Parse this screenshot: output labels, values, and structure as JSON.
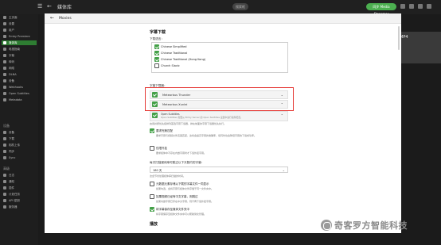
{
  "app": {
    "title": "媒体库",
    "pills": [
      "搜索框"
    ],
    "sync_label": "同步 Media Streamer"
  },
  "sidebar": {
    "items": [
      {
        "label": "主页面",
        "icon": "home-icon"
      },
      {
        "label": "设置",
        "icon": "gear-icon"
      },
      {
        "label": "用户",
        "icon": "user-icon"
      },
      {
        "label": "Emby Premiere",
        "icon": "star-icon"
      },
      {
        "label": "媒体库",
        "icon": "library-icon"
      },
      {
        "label": "电视指南",
        "icon": "tv-icon"
      },
      {
        "label": "字幕",
        "icon": "subtitle-icon"
      },
      {
        "label": "转码",
        "icon": "transcode-icon"
      },
      {
        "label": "网络",
        "icon": "network-icon"
      },
      {
        "label": "DLNA",
        "icon": "dlna-icon"
      },
      {
        "label": "设备",
        "icon": "device-icon"
      },
      {
        "label": "Webhooks",
        "icon": "webhook-icon"
      },
      {
        "label": "Open Subtitles",
        "icon": "plugin-icon"
      },
      {
        "label": "Metadata",
        "icon": "metadata-icon"
      }
    ],
    "section_heads": [
      "设备",
      "高级"
    ],
    "lower_items": [
      {
        "label": "设备",
        "icon": "device-icon"
      },
      {
        "label": "下载",
        "icon": "download-icon"
      },
      {
        "label": "相机上传",
        "icon": "camera-icon"
      },
      {
        "label": "同步",
        "icon": "sync-icon"
      },
      {
        "label": "Sync",
        "icon": "sync-icon"
      },
      {
        "label": "日志",
        "icon": "log-icon"
      },
      {
        "label": "通知",
        "icon": "bell-icon"
      },
      {
        "label": "插件",
        "icon": "plugin-icon"
      },
      {
        "label": "计划任务",
        "icon": "clock-icon"
      },
      {
        "label": "API 密钥",
        "icon": "key-icon"
      },
      {
        "label": "服务器",
        "icon": "server-icon"
      }
    ]
  },
  "background": {
    "right_text": "MP4"
  },
  "modal": {
    "title": "Movies",
    "section_subtitle_download": "字幕下载",
    "download_languages_label": "下载语言：",
    "languages": [
      {
        "name": "Chinese Simplified",
        "checked": true
      },
      {
        "name": "Chinese Traditional",
        "checked": true
      },
      {
        "name": "Chinese Traditional (Hong Kong)",
        "checked": true
      },
      {
        "name": "Church Slavic",
        "checked": false
      }
    ],
    "downloaders_label": "字幕下载器：",
    "downloaders": [
      {
        "name": "Meteorbus Thunder",
        "checked": true,
        "chevron": "⌄"
      },
      {
        "name": "Meteorbus Xunlei",
        "checked": true,
        "chevron": "⌃"
      }
    ],
    "open_subtitles": {
      "name": "Open Subtitles",
      "desc": "Open Subtitles 需要从 Emby Server 的 Open Subtitles 设置中进行插件配置。",
      "checked": true,
      "chevron": "⌃"
    },
    "downloader_order_desc": "启用并按优先级排列首选字幕下载器，排在前面的字幕下载器优先执行。",
    "options": [
      {
        "label": "要求完美匹配",
        "checked": true,
        "desc": "要求字幕与视频文件完美匹配，这将会提高字幕的准确率，但同时也会降低字幕的下载成功率。"
      },
      {
        "label": "仅限外挂",
        "checked": false,
        "desc": "要求媒体中不存在内嵌字幕时才下载外挂字幕。"
      }
    ],
    "skip_label": "每次扫描媒体库时跳过以下天数内的字幕：",
    "skip_value": "180 天",
    "skip_desc": "这会节省处理媒体库扫描的时间。",
    "options2": [
      {
        "label": "元数据元素存储以下载的字幕文件一同显示",
        "checked": false,
        "desc": "如果勾选，会将字幕与媒体文件存储于同一文件夹中。"
      },
      {
        "label": "如果视频已经有中文字幕，则跳过",
        "checked": false,
        "desc": "如果内嵌字幕已存在中文字幕，则不再下载外挂字幕。"
      },
      {
        "label": "将字幕保存至媒体文件夹中",
        "checked": true,
        "desc": "将字幕保存至媒体文件夹中可以帮助简化管理。"
      }
    ],
    "next_section": "播放"
  },
  "watermark": {
    "text": "奇客罗方智能科技"
  },
  "colors": {
    "accent": "#43a047",
    "highlight": "#e53935"
  }
}
